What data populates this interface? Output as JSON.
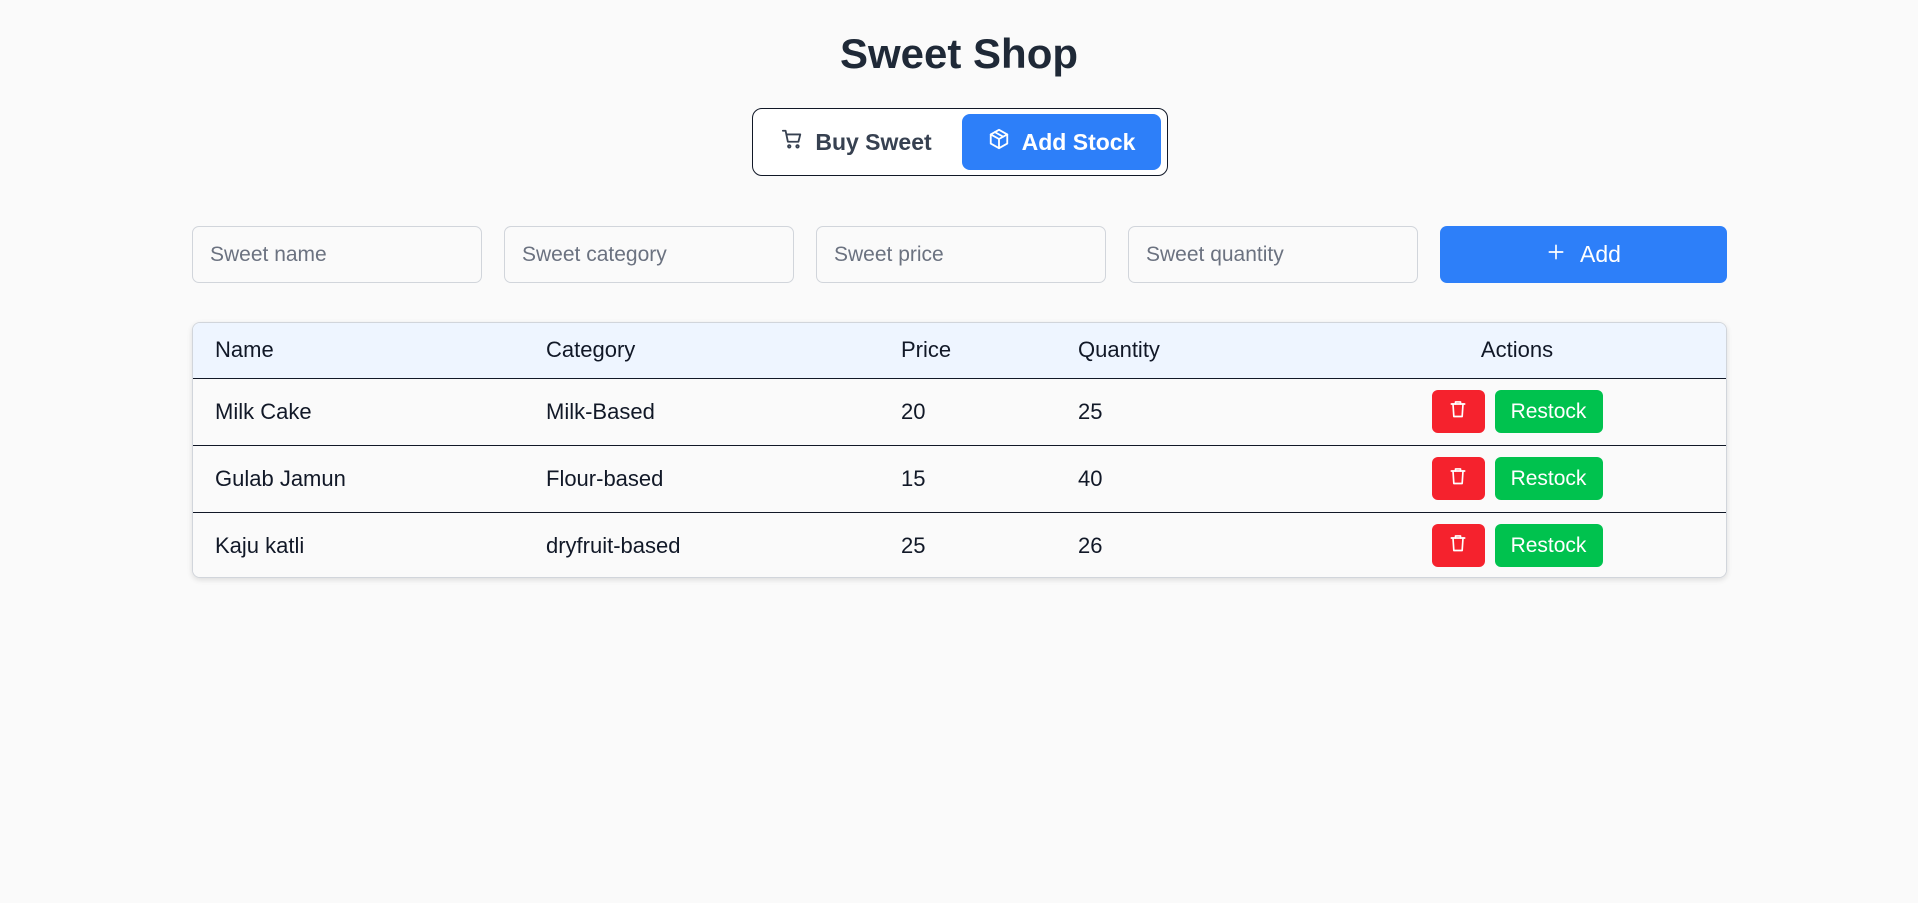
{
  "page": {
    "title": "Sweet Shop"
  },
  "mode_toggle": {
    "buy_label": "Buy Sweet",
    "buy_icon": "cart-icon",
    "add_label": "Add Stock",
    "add_icon": "package-icon",
    "active": "Add Stock"
  },
  "form": {
    "name_placeholder": "Sweet name",
    "category_placeholder": "Sweet category",
    "price_placeholder": "Sweet price",
    "quantity_placeholder": "Sweet quantity",
    "add_label": "Add",
    "add_icon": "plus-icon"
  },
  "table": {
    "headers": {
      "name": "Name",
      "category": "Category",
      "price": "Price",
      "quantity": "Quantity",
      "actions": "Actions"
    },
    "rows": [
      {
        "name": "Milk Cake",
        "category": "Milk-Based",
        "price": "20",
        "quantity": "25",
        "restock_label": "Restock"
      },
      {
        "name": "Gulab Jamun",
        "category": "Flour-based",
        "price": "15",
        "quantity": "40",
        "restock_label": "Restock"
      },
      {
        "name": "Kaju katli",
        "category": "dryfruit-based",
        "price": "25",
        "quantity": "26",
        "restock_label": "Restock"
      }
    ]
  },
  "colors": {
    "primary": "#2d7ff9",
    "danger": "#f5222d",
    "success": "#00c24e",
    "header_bg": "#eef5ff",
    "background": "#fafafa"
  }
}
